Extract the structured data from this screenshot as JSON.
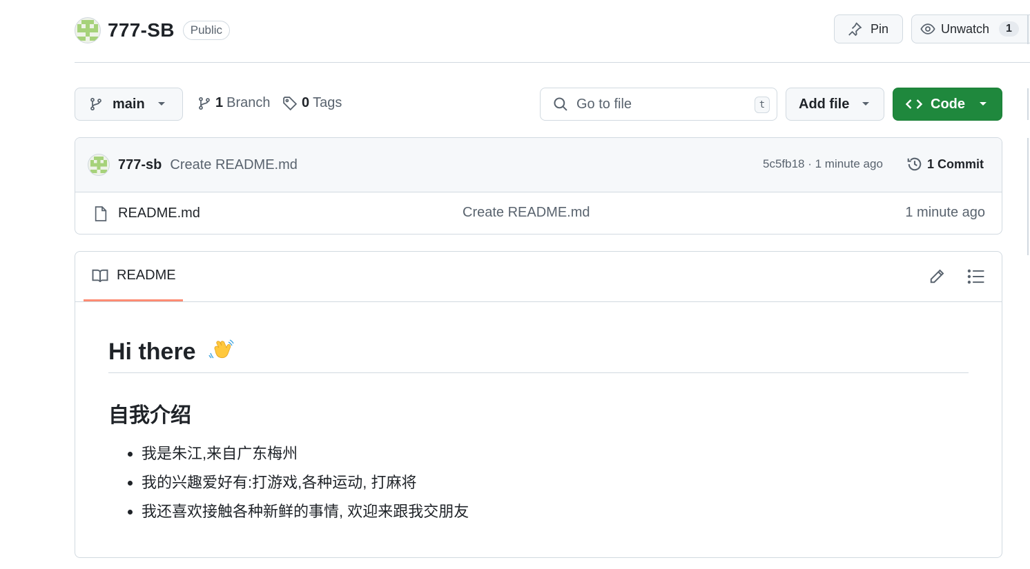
{
  "repo": {
    "name": "777-SB",
    "visibility": "Public"
  },
  "header_actions": {
    "pin_label": "Pin",
    "watch_label": "Unwatch",
    "watch_count": "1"
  },
  "nav": {
    "branch": "main",
    "branches_count": "1",
    "branches_label": "Branch",
    "tags_count": "0",
    "tags_label": "Tags",
    "search_placeholder": "Go to file",
    "search_shortcut": "t",
    "add_file_label": "Add file",
    "code_label": "Code"
  },
  "latest_commit": {
    "author": "777-sb",
    "message": "Create README.md",
    "meta": "5c5fb18 · 1 minute ago",
    "commits_label": "1 Commit"
  },
  "files": [
    {
      "name": "README.md",
      "commit_message": "Create README.md",
      "time": "1 minute ago"
    }
  ],
  "readme": {
    "tab_label": "README",
    "heading": "Hi there",
    "section_title": "自我介绍",
    "items": [
      "我是朱江,来自广东梅州",
      "我的兴趣爱好有:打游戏,各种运动, 打麻将",
      "我还喜欢接触各种新鲜的事情, 欢迎来跟我交朋友"
    ]
  },
  "colors": {
    "accent_green": "#1f883d",
    "tab_underline": "#fd8c73",
    "border": "#d1d9e0",
    "muted_text": "#59636e"
  },
  "icons": [
    "identicon-avatar",
    "pin-icon",
    "eye-icon",
    "git-branch-icon",
    "tag-icon",
    "search-icon",
    "code-icon",
    "history-icon",
    "file-icon",
    "book-icon",
    "pencil-icon",
    "list-icon",
    "waving-hand-emoji"
  ]
}
